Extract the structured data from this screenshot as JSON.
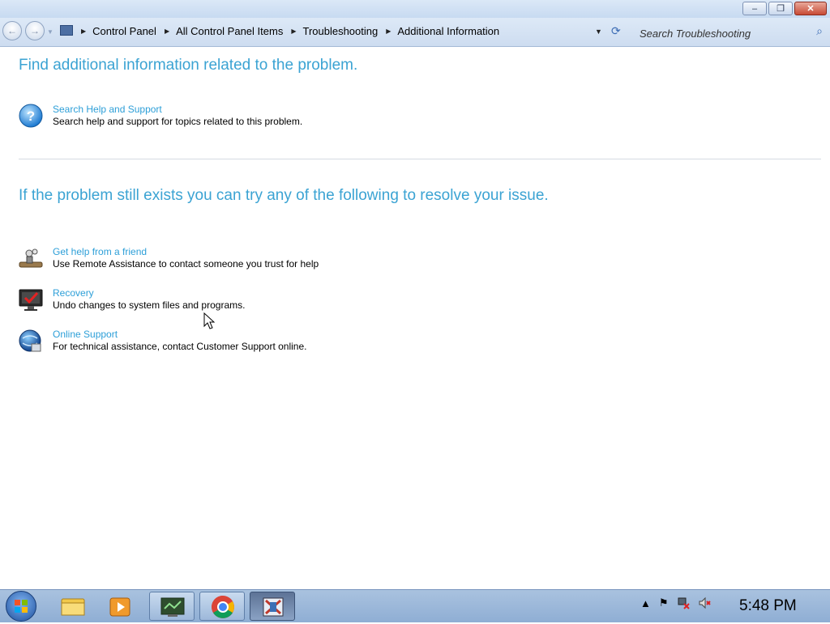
{
  "window": {
    "caption_minimize": "–",
    "caption_restore": "❐",
    "caption_close": "✕"
  },
  "address_bar": {
    "breadcrumbs": [
      "Control Panel",
      "All Control Panel Items",
      "Troubleshooting",
      "Additional Information"
    ],
    "search_placeholder": "Search Troubleshooting"
  },
  "main": {
    "heading_1": "Find additional information related to the problem.",
    "heading_2": "If the problem still exists you can try any of the following to resolve your issue.",
    "help_tasks": [
      {
        "title": "Search Help and Support",
        "description": "Search help and support for topics related to this problem.",
        "icon": "help-icon"
      }
    ],
    "resolve_tasks": [
      {
        "title": "Get help from a friend",
        "description": "Use Remote Assistance to contact someone you trust for help",
        "icon": "remote-assistance-icon"
      },
      {
        "title": "Recovery",
        "description": "Undo changes to system files and programs.",
        "icon": "recovery-icon"
      },
      {
        "title": "Online Support",
        "description": "For technical assistance, contact Customer Support online.",
        "icon": "online-support-icon"
      }
    ]
  },
  "taskbar": {
    "apps": [
      "explorer-icon",
      "media-player-icon",
      "control-panel-icon",
      "chrome-icon",
      "troubleshooter-icon"
    ],
    "clock": "5:48 PM"
  },
  "colors": {
    "heading": "#3ba3d3",
    "link": "#2d9fd8",
    "taskbar": "#a9c2df"
  }
}
